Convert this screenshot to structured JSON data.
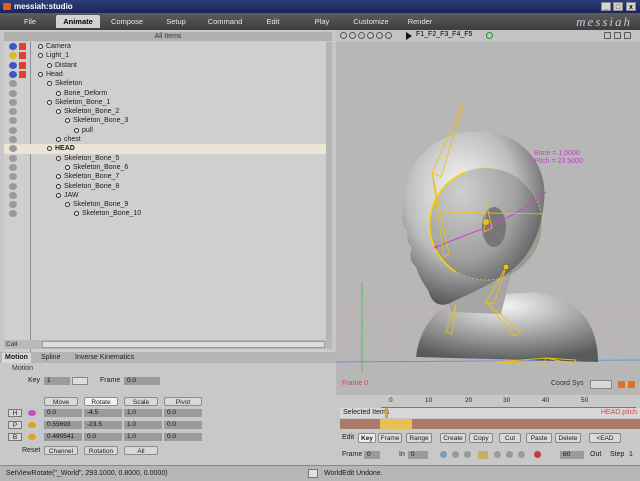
{
  "window": {
    "title": "messiah:studio",
    "min_label": "_",
    "max_label": "□",
    "close_label": "x"
  },
  "menu": {
    "tabs": [
      "File",
      "Animate",
      "Compose",
      "Setup",
      "Command",
      "Edit",
      "Play",
      "Customize",
      "Render"
    ],
    "active": "Animate",
    "logo": "messiah"
  },
  "items_header": "All Items",
  "tree": [
    {
      "label": "Camera",
      "depth": 0
    },
    {
      "label": "Light_1",
      "depth": 0
    },
    {
      "label": "Distant",
      "depth": 1
    },
    {
      "label": "Head",
      "depth": 0
    },
    {
      "label": "Skeleton",
      "depth": 1
    },
    {
      "label": "Bone_Deform",
      "depth": 2
    },
    {
      "label": "Skeleton_Bone_1",
      "depth": 1
    },
    {
      "label": "Skeleton_Bone_2",
      "depth": 2
    },
    {
      "label": "Skeleton_Bone_3",
      "depth": 3
    },
    {
      "label": "pull",
      "depth": 4
    },
    {
      "label": "chest",
      "depth": 2
    },
    {
      "label": "HEAD",
      "depth": 1,
      "selected": true
    },
    {
      "label": "Skeleton_Bone_5",
      "depth": 2
    },
    {
      "label": "Skeleton_Bone_6",
      "depth": 3
    },
    {
      "label": "Skeleton_Bone_7",
      "depth": 2
    },
    {
      "label": "Skeleton_Bone_8",
      "depth": 2
    },
    {
      "label": "JAW",
      "depth": 2
    },
    {
      "label": "Skeleton_Bone_9",
      "depth": 3
    },
    {
      "label": "Skeleton_Bone_10",
      "depth": 4
    }
  ],
  "tree_footer": {
    "coll": "Coll"
  },
  "viewport": {
    "frames": "F1_F2_F3_F4_F5",
    "readout": [
      "Bone = 1.0000",
      "Pitch = 23.5000"
    ],
    "frame_label": "Frame 0",
    "coord_sys": "Coord Sys"
  },
  "timeline": {
    "ticks": [
      "0",
      "10",
      "20",
      "30",
      "40",
      "50"
    ],
    "selected_items": "Selected Items",
    "track_label": "HEAD.pitch",
    "edit_label": "Edit",
    "buttons": [
      "Key",
      "Frame",
      "Range",
      "Create",
      "Copy",
      "Cut",
      "Paste",
      "Delete",
      "<EAD"
    ],
    "active_button": "Key",
    "frame_label": "Frame",
    "frame_value": "0",
    "in_label": "In",
    "in_value": "0",
    "out_value": "60",
    "out_label": "Out",
    "step_label": "Step",
    "step_value": "1"
  },
  "motion": {
    "tabs": [
      "Motion",
      "Spline",
      "Inverse Kinematics"
    ],
    "active_tab": "Motion",
    "section": "Motion",
    "key_label": "Key",
    "key_value": "1",
    "frame_label": "Frame",
    "frame_value": "0.0",
    "columns": [
      "Move",
      "Rotate",
      "Scale",
      "Pivot"
    ],
    "active_column": "Rotate",
    "rows": [
      {
        "axis": "H",
        "move": "0.0",
        "rotate": "-4.5",
        "scale": "1.0",
        "pivot": "0.0"
      },
      {
        "axis": "P",
        "move": "0.55693",
        "rotate": "-23.5",
        "scale": "1.0",
        "pivot": "0.0"
      },
      {
        "axis": "B",
        "move": "0.490541",
        "rotate": "0.0",
        "scale": "1.0",
        "pivot": "0.0"
      }
    ],
    "reset_label": "Reset",
    "bottom_buttons": [
      "Channel",
      "Rotation",
      "All"
    ]
  },
  "status": {
    "left": "SetViewRotate(\"_World\", 293.1000, 0.8000, 0.0000)",
    "right": "WorldEdit Undone."
  },
  "colors": {
    "accent": "#2d3e7a",
    "bone": "#e8c020",
    "readout": "#c040c0"
  }
}
